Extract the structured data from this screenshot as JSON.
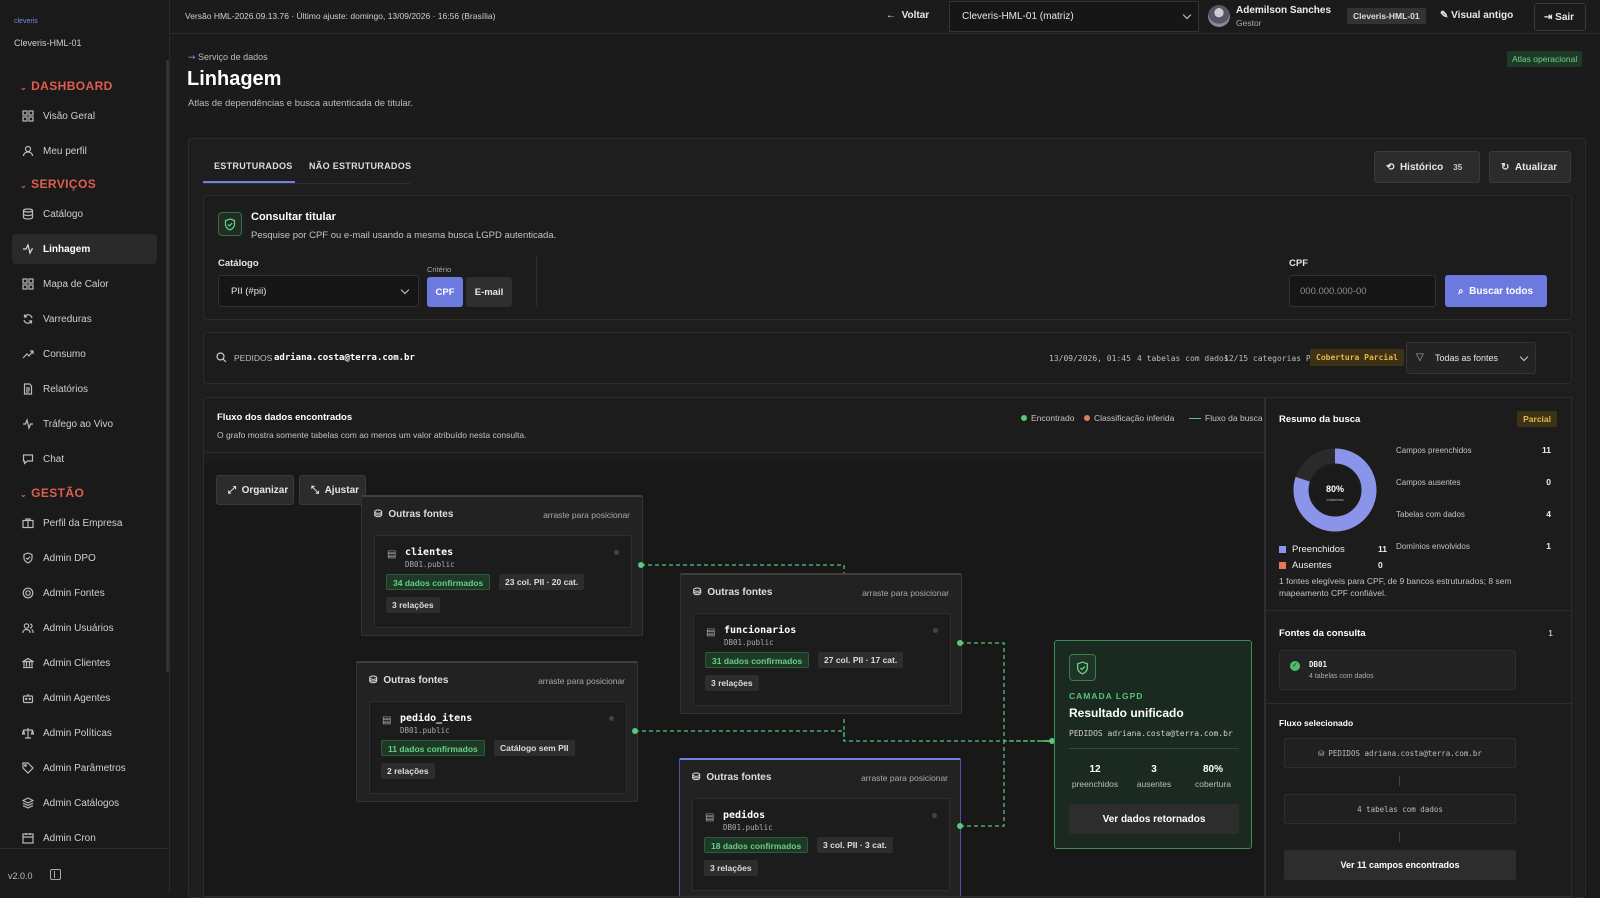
{
  "sidebar": {
    "brand": "cleveris",
    "tenant": "Cleveris-HML-01",
    "version": "v2.0.0",
    "sections": {
      "dashboard": "DASHBOARD",
      "servicos": "SERVIÇOS",
      "gestao": "GESTÃO"
    },
    "items": [
      {
        "label": "Visão Geral",
        "icon": "grid-icon"
      },
      {
        "label": "Meu perfil",
        "icon": "user-icon"
      },
      {
        "label": "Catálogo",
        "icon": "database-icon"
      },
      {
        "label": "Linhagem",
        "icon": "lineage-icon",
        "active": true
      },
      {
        "label": "Mapa de Calor",
        "icon": "grid-icon"
      },
      {
        "label": "Varreduras",
        "icon": "refresh-icon"
      },
      {
        "label": "Consumo",
        "icon": "trend-icon"
      },
      {
        "label": "Relatórios",
        "icon": "document-icon"
      },
      {
        "label": "Tráfego ao Vivo",
        "icon": "pulse-icon"
      },
      {
        "label": "Chat",
        "icon": "chat-icon"
      },
      {
        "label": "Perfil da Empresa",
        "icon": "briefcase-icon"
      },
      {
        "label": "Admin DPO",
        "icon": "shield-icon"
      },
      {
        "label": "Admin Fontes",
        "icon": "target-icon"
      },
      {
        "label": "Admin Usuários",
        "icon": "users-icon"
      },
      {
        "label": "Admin Clientes",
        "icon": "bank-icon"
      },
      {
        "label": "Admin Agentes",
        "icon": "robot-icon"
      },
      {
        "label": "Admin Políticas",
        "icon": "scale-icon"
      },
      {
        "label": "Admin Parâmetros",
        "icon": "tag-icon"
      },
      {
        "label": "Admin Catálogos",
        "icon": "layers-icon"
      },
      {
        "label": "Admin Cron",
        "icon": "calendar-icon"
      }
    ]
  },
  "topbar": {
    "version_text": "Versão HML-2026.09.13.76 · Último ajuste: domingo, 13/09/2026 · 16:56 (Brasília)",
    "back_label": "Voltar",
    "environment": "Cleveris-HML-01 (matriz)",
    "user_name": "Ademilson Sanches",
    "user_role": "Gestor",
    "tenant_badge": "Cleveris-HML-01",
    "legacy_label": "Visual antigo",
    "exit_label": "Sair"
  },
  "header": {
    "breadcrumb": "Serviço de dados",
    "title": "Linhagem",
    "subtitle": "Atlas de dependências e busca autenticada de titular.",
    "badge": "Atlas operacional"
  },
  "tabs": {
    "structured": "ESTRUTURADOS",
    "unstructured": "NÃO ESTRUTURADOS",
    "history_label": "Histórico",
    "history_count": "35",
    "refresh_label": "Atualizar"
  },
  "consult": {
    "title": "Consultar titular",
    "subtitle": "Pesquise por CPF ou e-mail usando a mesma busca LGPD autenticada.",
    "catalog_label": "Catálogo",
    "catalog_value": "PII (#pii)",
    "criteria_label": "Critério",
    "criteria_cpf": "CPF",
    "criteria_email": "E-mail",
    "cpf_label": "CPF",
    "cpf_placeholder": "000.000.000-00",
    "search_all": "Buscar todos"
  },
  "query": {
    "label": "PEDIDOS",
    "value": "adriana.costa@terra.com.br",
    "timestamp": "13/09/2026, 01:45",
    "tables": "4 tabelas com dados",
    "categories": "12/15 categorias PII",
    "coverage_badge": "Cobertura Parcial",
    "filter": "Todas as fontes"
  },
  "flow": {
    "title": "Fluxo dos dados encontrados",
    "subtitle": "O grafo mostra somente tabelas com ao menos um valor atribuído nesta consulta.",
    "legend_found": "Encontrado",
    "legend_inferred": "Classificação inferida",
    "legend_flow": "Fluxo da busca",
    "organize": "Organizar",
    "adjust": "Ajustar",
    "drag_hint": "arraste para posicionar",
    "source_label": "Outras fontes",
    "nodes": [
      {
        "table": "clientes",
        "schema": "DB01.public",
        "confirmed": "34 dados confirmados",
        "cols": "23 col. PII · 20 cat.",
        "relations": "3 relações"
      },
      {
        "table": "funcionarios",
        "schema": "DB01.public",
        "confirmed": "31 dados confirmados",
        "cols": "27 col. PII · 17 cat.",
        "relations": "3 relações"
      },
      {
        "table": "pedido_itens",
        "schema": "DB01.public",
        "confirmed": "11 dados confirmados",
        "cols": "Catálogo sem PII",
        "relations": "2 relações"
      },
      {
        "table": "pedidos",
        "schema": "DB01.public",
        "confirmed": "18 dados confirmados",
        "cols": "3 col. PII · 3 cat.",
        "relations": "3 relações"
      }
    ],
    "result": {
      "kicker": "CAMADA LGPD",
      "title": "Resultado unificado",
      "query": "PEDIDOS adriana.costa@terra.com.br",
      "filled": "12",
      "filled_label": "preenchidos",
      "absent": "3",
      "absent_label": "ausentes",
      "coverage": "80%",
      "coverage_label": "cobertura",
      "button": "Ver dados retornados"
    }
  },
  "summary": {
    "title": "Resumo da busca",
    "badge": "Parcial",
    "donut_pct": "80%",
    "donut_label": "cobertura",
    "donut_fraction": 0.8,
    "rows": [
      {
        "label": "Campos preenchidos",
        "value": "11"
      },
      {
        "label": "Campos ausentes",
        "value": "0"
      },
      {
        "label": "Tabelas com dados",
        "value": "4"
      },
      {
        "label": "Domínios envolvidos",
        "value": "1"
      }
    ],
    "legend_filled": "Preenchidos",
    "legend_filled_value": "11",
    "legend_absent": "Ausentes",
    "legend_absent_value": "0",
    "note": "1 fontes elegíveis para CPF, de 9 bancos estruturados; 8 sem mapeamento CPF confiável.",
    "sources_title": "Fontes da consulta",
    "sources_count": "1",
    "source_name": "DB01",
    "source_desc": "4 tabelas com dados",
    "selected_flow_title": "Fluxo selecionado",
    "flow_query": "PEDIDOS adriana.costa@terra.com.br",
    "flow_tables": "4 tabelas com dados",
    "flow_button": "Ver 11 campos encontrados"
  },
  "colors": {
    "accent": "#6c7adf",
    "found": "#58c879",
    "inferred": "#e3785a",
    "warning": "#e5b54a",
    "danger": "#e05d4f"
  }
}
